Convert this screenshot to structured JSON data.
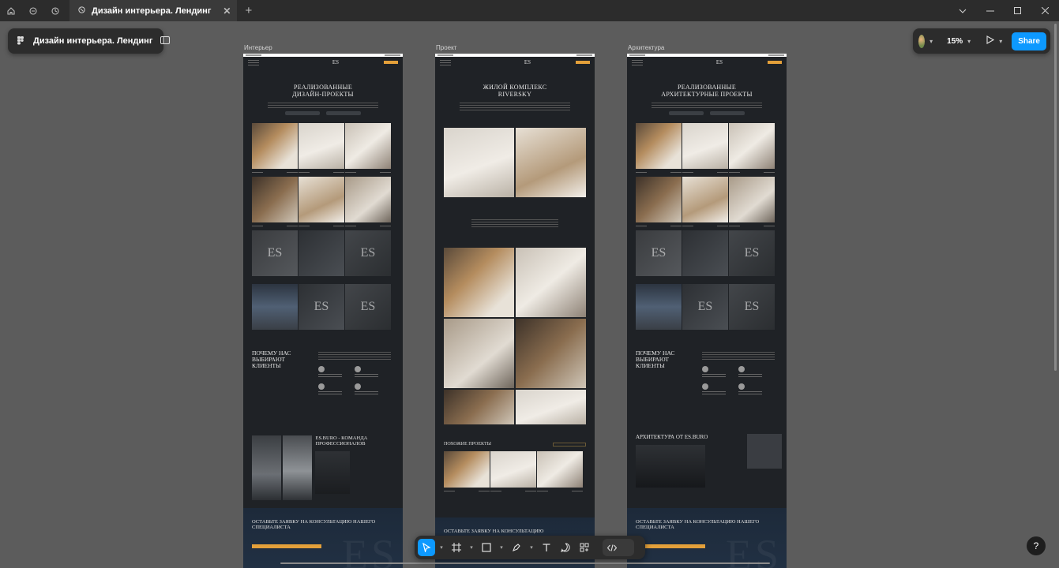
{
  "tabbar": {
    "tab_title": "Дизайн интерьера. Лендинг",
    "close_glyph": "✕",
    "add_glyph": "+"
  },
  "file_panel": {
    "file_name": "Дизайн интерьера. Лендинг"
  },
  "right_panel": {
    "zoom": "15%",
    "share_label": "Share"
  },
  "frames": [
    {
      "label": "Интерьер"
    },
    {
      "label": "Проект"
    },
    {
      "label": "Архитектура"
    }
  ],
  "interior": {
    "logo": "ES",
    "hero_title_1": "Реализованные",
    "hero_title_2": "дизайн-проекты",
    "why_title": "Почему нас выбирают клиенты",
    "team_title": "ES.BURO - команда профессионалов",
    "consult_title": "Оставьте заявку на консультацию нашего специалиста"
  },
  "project": {
    "logo": "ES",
    "hero_title_1": "Жилой комплекс",
    "hero_title_2": "Riversky",
    "similar_title": "Похожие проекты",
    "consult_title": "Оставьте заявку на консультацию"
  },
  "architecture": {
    "logo": "ES",
    "hero_title_1": "Реализованные",
    "hero_title_2": "архитектурные проекты",
    "why_title": "Почему нас выбирают клиенты",
    "arch_title": "Архитектура от ES.BURO",
    "consult_title": "Оставьте заявку на консультацию нашего специалиста"
  },
  "toolbar": {
    "help": "?"
  },
  "colors": {
    "accent": "#0d99ff",
    "frame_bg": "#1f2226",
    "canvas": "#5c5c5c",
    "orange": "#e3a03a"
  },
  "icons": [
    "home-icon",
    "drafts-icon",
    "figma-file-icon",
    "layout-toggle-icon",
    "move-tool-icon",
    "frame-tool-icon",
    "rectangle-tool-icon",
    "pen-tool-icon",
    "text-tool-icon",
    "comment-tool-icon",
    "components-icon",
    "dev-mode-icon",
    "play-icon"
  ]
}
